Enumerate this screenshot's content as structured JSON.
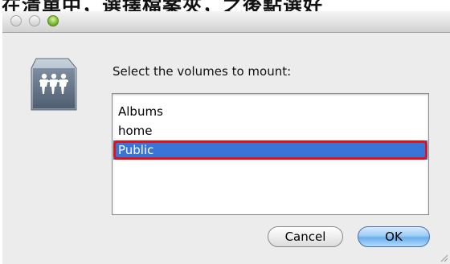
{
  "caption": {
    "text": "在清單中，選擇檔案夾，之後點選好"
  },
  "dialog": {
    "icon": "network-volume-icon",
    "prompt": "Select the volumes to mount:",
    "volumes": [
      {
        "label": "Albums",
        "selected": false
      },
      {
        "label": "home",
        "selected": false
      },
      {
        "label": "Public",
        "selected": true
      }
    ],
    "cancel_label": "Cancel",
    "ok_label": "OK"
  },
  "colors": {
    "selection": "#3875d7",
    "annotation_outline": "#e3101a",
    "window_background": "#ececec"
  }
}
